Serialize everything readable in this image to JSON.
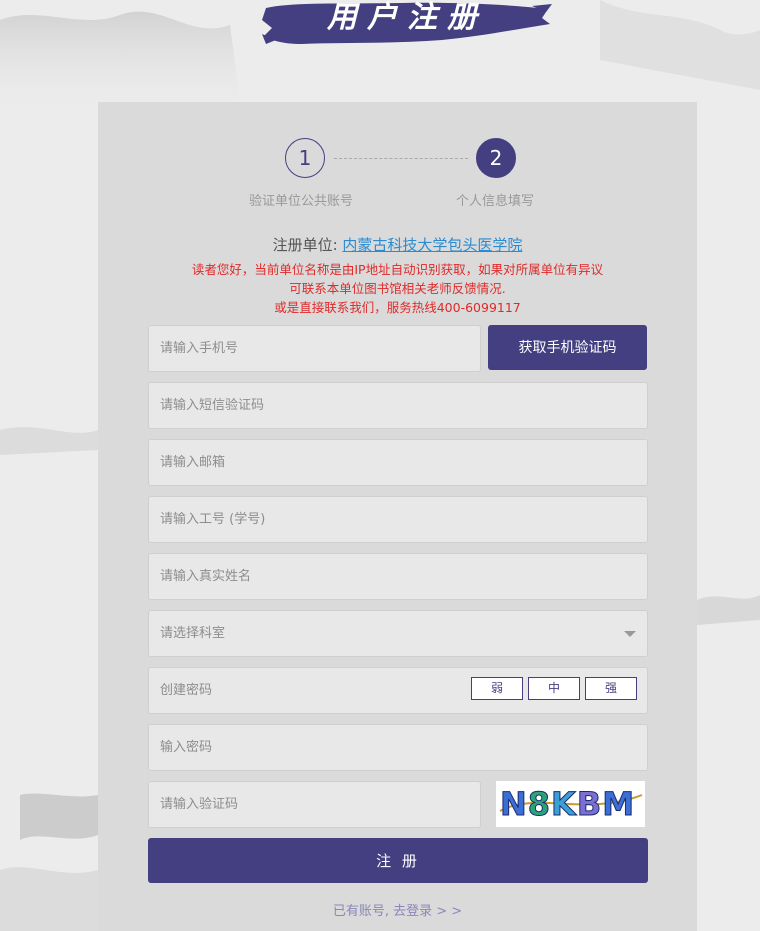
{
  "page": {
    "title": "用户注册"
  },
  "steps": [
    {
      "number": "1",
      "label": "验证单位公共账号"
    },
    {
      "number": "2",
      "label": "个人信息填写"
    }
  ],
  "unit": {
    "prefix": "注册单位:",
    "name": "内蒙古科技大学包头医学院"
  },
  "notice": {
    "line1": "读者您好，当前单位名称是由IP地址自动识别获取，如果对所属单位有异议",
    "line2": "可联系本单位图书馆相关老师反馈情况.",
    "line3": "或是直接联系我们，服务热线400-6099117"
  },
  "form": {
    "phone_placeholder": "请输入手机号",
    "sms_button": "获取手机验证码",
    "sms_code_placeholder": "请输入短信验证码",
    "email_placeholder": "请输入邮箱",
    "id_placeholder": "请输入工号 (学号)",
    "name_placeholder": "请输入真实姓名",
    "department_placeholder": "请选择科室",
    "password_placeholder": "创建密码",
    "strength": {
      "weak": "弱",
      "medium": "中",
      "strong": "强"
    },
    "confirm_placeholder": "输入密码",
    "captcha_placeholder": "请输入验证码",
    "captcha_text": "N8KBM",
    "submit": "注 册",
    "login_link": "已有账号, 去登录 > >"
  },
  "colors": {
    "accent": "#433f80",
    "notice": "#e02a2a",
    "link": "#2a8bd1"
  }
}
